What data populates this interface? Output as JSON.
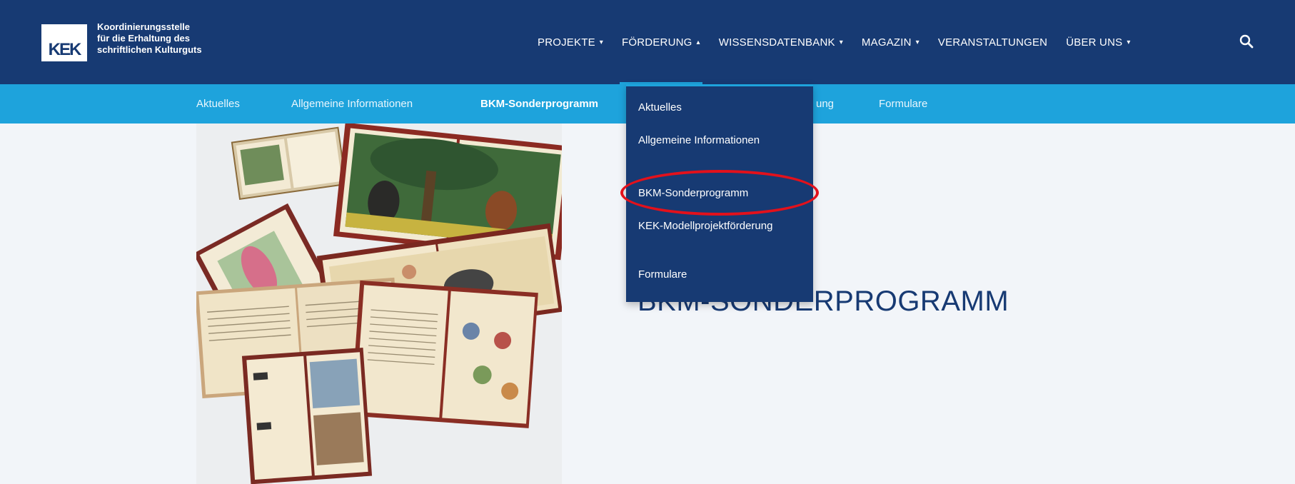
{
  "header": {
    "logo_text": "KEK",
    "org_lines": [
      "Koordinierungsstelle",
      "für die Erhaltung des",
      "schriftlichen Kulturguts"
    ],
    "background": "#173a73",
    "accent": "#1ea3dc"
  },
  "mainnav": {
    "items": [
      {
        "label": "PROJEKTE",
        "caret": "▾"
      },
      {
        "label": "FÖRDERUNG",
        "caret": "▴"
      },
      {
        "label": "WISSENSDATENBANK",
        "caret": "▾"
      },
      {
        "label": "MAGAZIN",
        "caret": "▾"
      },
      {
        "label": "VERANSTALTUNGEN",
        "caret": ""
      },
      {
        "label": "ÜBER UNS",
        "caret": "▾"
      }
    ],
    "search_icon": "search-icon"
  },
  "subnav": {
    "items": [
      {
        "label": "Aktuelles"
      },
      {
        "label": "Allgemeine Informationen"
      },
      {
        "label": "BKM-Sonderprogramm"
      },
      {
        "label": "ung"
      },
      {
        "label": "Formulare"
      }
    ]
  },
  "dropdown": {
    "items": [
      {
        "label": "Aktuelles"
      },
      {
        "label": "Allgemeine Informationen"
      },
      {
        "label": "BKM-Sonderprogramm"
      },
      {
        "label": "KEK-Modellprojektförderung"
      },
      {
        "label": "Formulare"
      }
    ],
    "highlighted": "BKM-Sonderprogramm",
    "highlight_color": "#e3111b"
  },
  "main": {
    "title": "BKM-SONDERPROGRAMM",
    "hero_image": "Historische Kinderbücher"
  }
}
